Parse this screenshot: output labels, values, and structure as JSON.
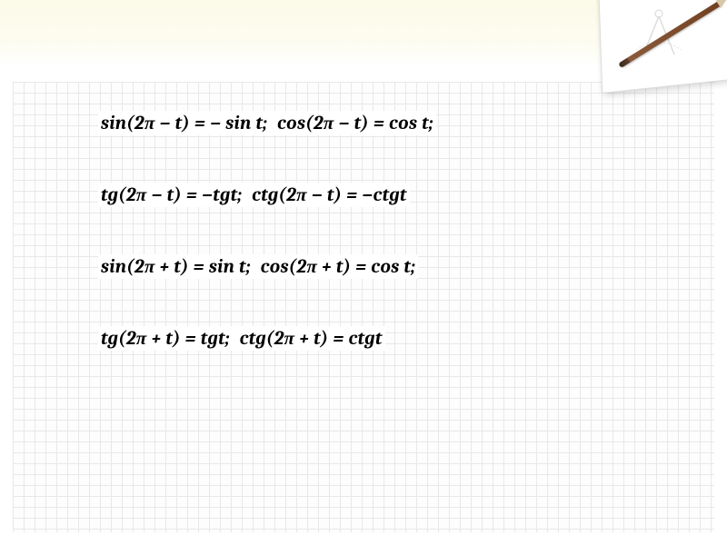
{
  "formulas": {
    "line1_a": "sin(2π − t) = − sin t;",
    "line1_b": "cos(2π − t) = cos t;",
    "line2_a": "tg(2π − t) = −tgt;",
    "line2_b": "ctg(2π − t) = −ctgt",
    "line3_a": "sin(2π + t) = sin t;",
    "line3_b": "cos(2π + t) = cos t;",
    "line4_a": "tg(2π + t) = tgt;",
    "line4_b": "ctg(2π + t) = ctgt"
  }
}
